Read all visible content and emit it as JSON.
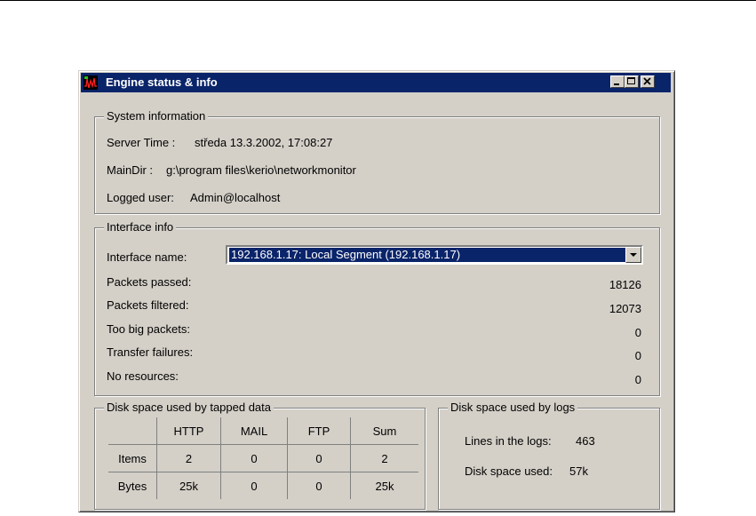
{
  "window": {
    "title": "Engine status & info",
    "icon": "network-monitor-icon",
    "controls": [
      "minimize-icon",
      "maximize-icon",
      "close-icon"
    ]
  },
  "system": {
    "legend": "System information",
    "server_time_label": "Server Time :",
    "server_time_value": "středa 13.3.2002, 17:08:27",
    "maindir_label": "MainDir :",
    "maindir_value": "g:\\program files\\kerio\\networkmonitor",
    "user_label": "Logged user:",
    "user_value": "Admin@localhost"
  },
  "interface": {
    "legend": "Interface info",
    "name_label": "Interface name:",
    "selected": "192.168.1.17: Local Segment (192.168.1.17)",
    "stats": [
      {
        "label": "Packets passed:",
        "value": "18126"
      },
      {
        "label": "Packets filtered:",
        "value": "12073"
      },
      {
        "label": "Too big packets:",
        "value": "0"
      },
      {
        "label": "Transfer failures:",
        "value": "0"
      },
      {
        "label": "No resources:",
        "value": "0"
      }
    ]
  },
  "tapped": {
    "legend": "Disk space used by tapped data",
    "columns": [
      "",
      "HTTP",
      "MAIL",
      "FTP",
      "Sum"
    ],
    "rows": [
      [
        "Items",
        "2",
        "0",
        "0",
        "2"
      ],
      [
        "Bytes",
        "25k",
        "0",
        "0",
        "25k"
      ]
    ]
  },
  "logs": {
    "legend": "Disk space used by logs",
    "lines_label": "Lines in the logs:",
    "lines_value": "463",
    "disk_label": "Disk space used:",
    "disk_value": "57k"
  }
}
